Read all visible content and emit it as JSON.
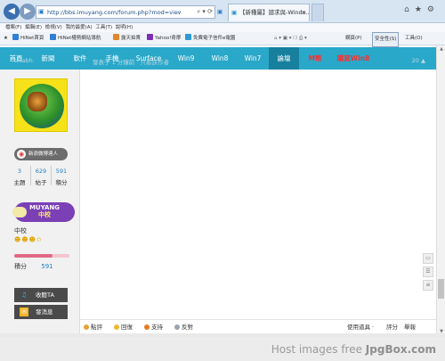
{
  "browser": {
    "url": "http://bbs.imuyang.com/forum.php?mod=viewthread&tid",
    "tab_title": "【新種屬】譜求與-Windo...",
    "menu": [
      "檔案(F)",
      "編輯(E)",
      "檢視(V)",
      "我的最愛(A)",
      "工具(T)",
      "說明(H)"
    ],
    "favorites": [
      "HiNet首頁",
      "HiNet權勢網站導航",
      "露天拍賣",
      "Yahoo!奇摩",
      "免費電子信件e電園"
    ],
    "commands": [
      "網頁(P)",
      "安全性(S)",
      "工具(O)"
    ]
  },
  "site_nav": {
    "items": [
      "首頁",
      "新聞",
      "軟件",
      "手機",
      "Surface",
      "Win9",
      "Win8",
      "Win7",
      "論壇",
      "M幣",
      "購買Win8"
    ],
    "active": "論壇"
  },
  "subhead": {
    "user": "thiabh",
    "info": "發表于 1 分鐘前 · 只看該作者",
    "floor": "20 ▲"
  },
  "user_panel": {
    "follow_label": "新浪微博達人",
    "stats": [
      {
        "value": "3",
        "label": "主題"
      },
      {
        "value": "629",
        "label": "帖子"
      },
      {
        "value": "591",
        "label": "積分"
      }
    ],
    "badge_title": "MUYANG",
    "badge_sub": "中校",
    "rank": "中校",
    "stars": "☻☻☻✩",
    "progress": 0.7,
    "points_label": "積分",
    "points_value": "591",
    "collect_label": "收聽TA",
    "message_label": "發消息"
  },
  "post_actions": {
    "left": [
      "點評",
      "回復",
      "支持",
      "反對"
    ],
    "right": [
      "使用道具 ·",
      "評分",
      "舉報"
    ]
  },
  "watermark": {
    "prefix": "Host images free ",
    "brand": "JpgBox.com"
  },
  "colors": {
    "nav_bg": "#2aa8c9",
    "nav_active": "#16809e",
    "badge": "#7b3fb6"
  }
}
